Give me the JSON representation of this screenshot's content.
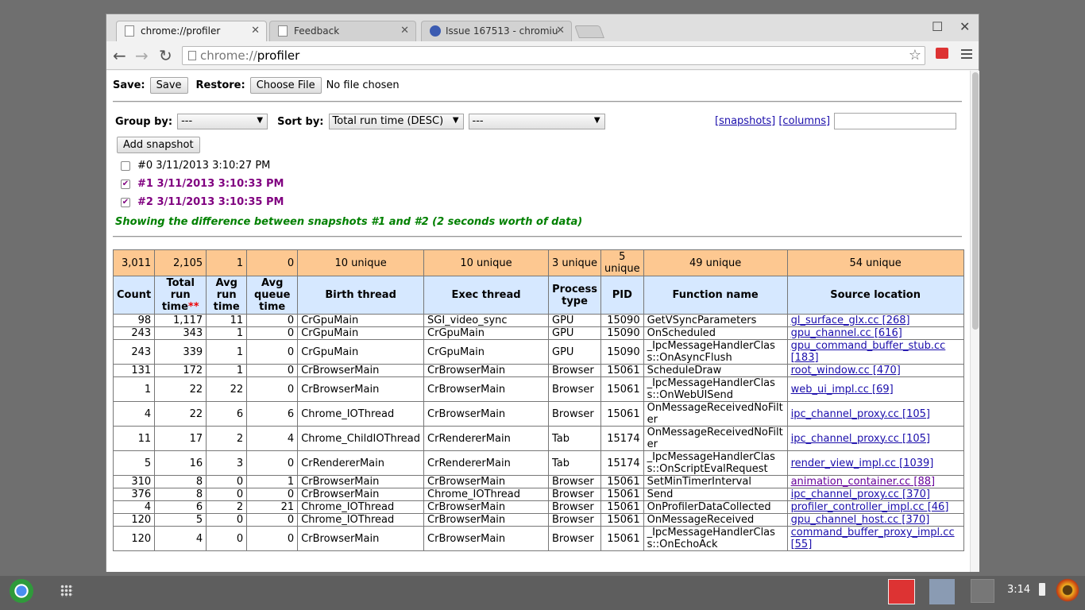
{
  "tabs": [
    {
      "title": "chrome://profiler"
    },
    {
      "title": "Feedback"
    },
    {
      "title": "Issue 167513 - chromiu"
    }
  ],
  "window_controls": {
    "maximize": "☐",
    "close": "✕"
  },
  "toolbar": {
    "back": "←",
    "forward": "→",
    "reload": "↻",
    "scheme": "chrome://",
    "host": "profiler",
    "star": "☆"
  },
  "controls": {
    "save_label": "Save:",
    "save_button": "Save",
    "restore_label": "Restore:",
    "choose_file": "Choose File",
    "no_file": "No file chosen",
    "group_by_label": "Group by:",
    "group_by_value": "---",
    "sort_by_label": "Sort by:",
    "sort_by_value": "Total run time (DESC)",
    "sort_by2_value": "---",
    "snapshots_link": "[snapshots]",
    "columns_link": "[columns]",
    "add_snapshot": "Add snapshot"
  },
  "snapshots": [
    {
      "label": "#0 3/11/2013 3:10:27 PM",
      "checked": false
    },
    {
      "label": "#1 3/11/2013 3:10:33 PM",
      "checked": true
    },
    {
      "label": "#2 3/11/2013 3:10:35 PM",
      "checked": true
    }
  ],
  "showing_text": "Showing the difference between snapshots #1 and #2 (2 seconds worth of data)",
  "summary": [
    "3,011",
    "2,105",
    "1",
    "0",
    "10 unique",
    "10 unique",
    "3 unique",
    "5 unique",
    "49 unique",
    "54 unique"
  ],
  "headers": [
    "Count",
    "Total run time",
    "Avg run time",
    "Avg queue time",
    "Birth thread",
    "Exec thread",
    "Process type",
    "PID",
    "Function name",
    "Source location"
  ],
  "sort_marker": "**",
  "rows": [
    [
      "98",
      "1,117",
      "11",
      "0",
      "CrGpuMain",
      "SGI_video_sync",
      "GPU",
      "15090",
      "GetVSyncParameters",
      "gl_surface_glx.cc [268]"
    ],
    [
      "243",
      "343",
      "1",
      "0",
      "CrGpuMain",
      "CrGpuMain",
      "GPU",
      "15090",
      "OnScheduled",
      "gpu_channel.cc [616]"
    ],
    [
      "243",
      "339",
      "1",
      "0",
      "CrGpuMain",
      "CrGpuMain",
      "GPU",
      "15090",
      "_IpcMessageHandlerClass::OnAsyncFlush",
      "gpu_command_buffer_stub.cc [183]"
    ],
    [
      "131",
      "172",
      "1",
      "0",
      "CrBrowserMain",
      "CrBrowserMain",
      "Browser",
      "15061",
      "ScheduleDraw",
      "root_window.cc [470]"
    ],
    [
      "1",
      "22",
      "22",
      "0",
      "CrBrowserMain",
      "CrBrowserMain",
      "Browser",
      "15061",
      "_IpcMessageHandlerClass::OnWebUISend",
      "web_ui_impl.cc [69]"
    ],
    [
      "4",
      "22",
      "6",
      "6",
      "Chrome_IOThread",
      "CrBrowserMain",
      "Browser",
      "15061",
      "OnMessageReceivedNoFilter",
      "ipc_channel_proxy.cc [105]"
    ],
    [
      "11",
      "17",
      "2",
      "4",
      "Chrome_ChildIOThread",
      "CrRendererMain",
      "Tab",
      "15174",
      "OnMessageReceivedNoFilter",
      "ipc_channel_proxy.cc [105]"
    ],
    [
      "5",
      "16",
      "3",
      "0",
      "CrRendererMain",
      "CrRendererMain",
      "Tab",
      "15174",
      "_IpcMessageHandlerClass::OnScriptEvalRequest",
      "render_view_impl.cc [1039]"
    ],
    [
      "310",
      "8",
      "0",
      "1",
      "CrBrowserMain",
      "CrBrowserMain",
      "Browser",
      "15061",
      "SetMinTimerInterval",
      "animation_container.cc [88]"
    ],
    [
      "376",
      "8",
      "0",
      "0",
      "CrBrowserMain",
      "Chrome_IOThread",
      "Browser",
      "15061",
      "Send",
      "ipc_channel_proxy.cc [370]"
    ],
    [
      "4",
      "6",
      "2",
      "21",
      "Chrome_IOThread",
      "CrBrowserMain",
      "Browser",
      "15061",
      "OnProfilerDataCollected",
      "profiler_controller_impl.cc [46]"
    ],
    [
      "120",
      "5",
      "0",
      "0",
      "Chrome_IOThread",
      "CrBrowserMain",
      "Browser",
      "15061",
      "OnMessageReceived",
      "gpu_channel_host.cc [370]"
    ],
    [
      "120",
      "4",
      "0",
      "0",
      "CrBrowserMain",
      "CrBrowserMain",
      "Browser",
      "15061",
      "_IpcMessageHandlerClass::OnEchoAck",
      "command_buffer_proxy_impl.cc [55]"
    ]
  ],
  "shelf": {
    "clock": "3:14"
  }
}
